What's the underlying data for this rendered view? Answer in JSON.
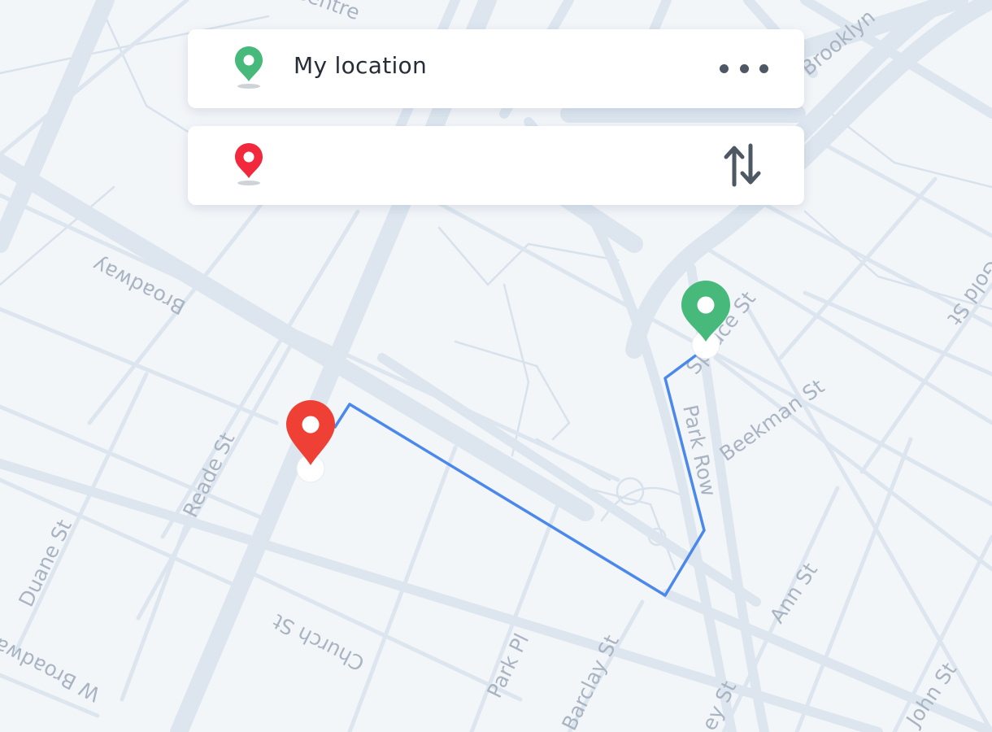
{
  "search": {
    "from_label": "My location",
    "to_placeholder": ""
  },
  "icons": {
    "origin": "green-location-pin-icon",
    "destination": "red-location-pin-icon",
    "more": "more-horizontal-icon",
    "swap": "swap-vertical-arrows-icon"
  },
  "map": {
    "streets": {
      "broadway": "Broadway",
      "reade": "Reade St",
      "duane": "Duane St",
      "w_broadway": "W Broadway",
      "church": "Church St",
      "park_pl": "Park Pl",
      "barclay": "Barclay St",
      "park_row": "Park Row",
      "beekman": "Beekman St",
      "spruce": "Spruce St",
      "ann": "Ann St",
      "john": "John St",
      "gold": "Gold St",
      "brooklyn": "Brooklyn",
      "centre": "Centre",
      "bottom_st": "ey St"
    }
  },
  "colors": {
    "origin_pin": "#46b97b",
    "destination_pin": "#ee4034",
    "card_destination_pin": "#f2283c",
    "route": "#4a88ec",
    "road": "#dde6ef",
    "background": "#f3f6f9",
    "label": "#a9b4c2"
  }
}
